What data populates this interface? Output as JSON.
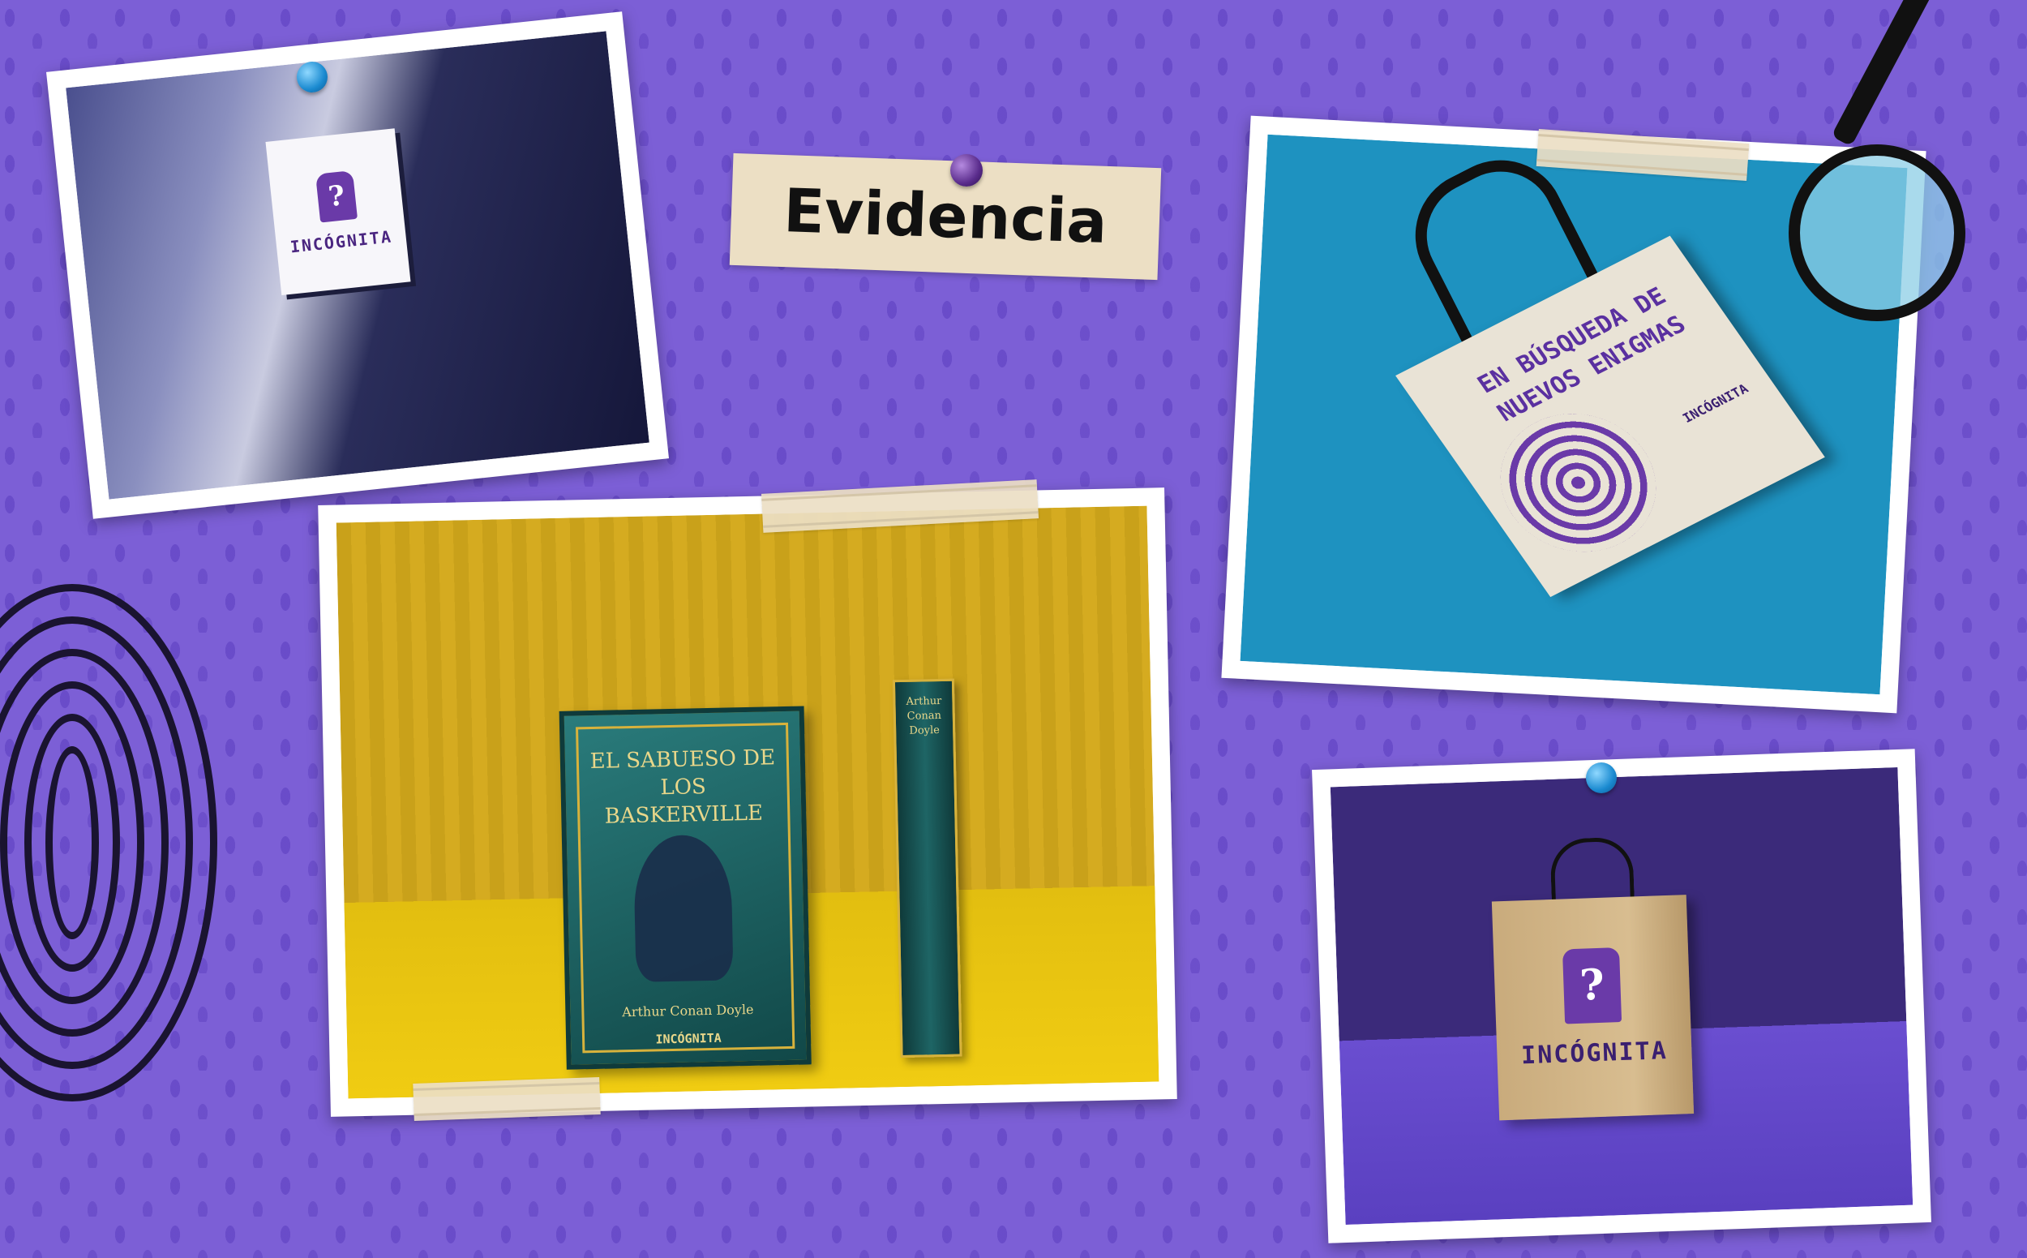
{
  "title": "Evidencia",
  "brand": "INCÓGNITA",
  "logo_symbol": "?",
  "book": {
    "title": "EL SABUESO DE LOS BASKERVILLE",
    "author": "Arthur Conan Doyle",
    "spine_author": "Arthur Conan Doyle",
    "brand": "INCÓGNITA"
  },
  "tote": {
    "slogan": "EN BÚSQUEDA DE NUEVOS ENIGMAS",
    "brand": "INCÓGNITA"
  },
  "colors": {
    "background": "#7c5fd6",
    "brand_purple": "#6a3aa8",
    "book_teal": "#1e6565",
    "mustard": "#c9a11a",
    "tote_blue": "#1e92c0"
  },
  "icons": [
    "pushpin-icon",
    "tape-strip",
    "fingerprint-icon",
    "magnifying-glass-icon",
    "question-mark-logo-icon"
  ]
}
